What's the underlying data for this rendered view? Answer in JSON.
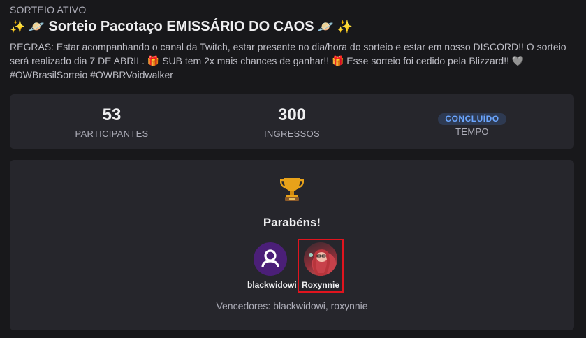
{
  "giveaway": {
    "status": "SORTEIO ATIVO",
    "title_emoji_left": "✨ 🪐",
    "title": "Sorteio Pacotaço EMISSÁRIO DO CAOS",
    "title_emoji_right": "🪐 ✨",
    "rules": "REGRAS: Estar acompanhando o canal da Twitch, estar presente no dia/hora do sorteio e estar em nosso DISCORD!! O sorteio será realizado dia 7 DE ABRIL. 🎁 SUB tem 2x mais chances de ganhar!! 🎁 Esse sorteio foi cedido pela Blizzard!! 🩶 #OWBrasilSorteio #OWBRVoidwalker"
  },
  "stats": {
    "participants_value": "53",
    "participants_label": "PARTICIPANTES",
    "tickets_value": "300",
    "tickets_label": "INGRESSOS",
    "time_badge": "CONCLUÍDO",
    "time_label": "TEMPO"
  },
  "result": {
    "trophy_icon": "trophy-icon",
    "congrats": "Parabéns!",
    "winners": [
      {
        "name": "blackwidowi",
        "avatar": "default-user-icon"
      },
      {
        "name": "Roxynnie",
        "avatar": "profile-photo"
      }
    ],
    "summary": "Vencedores: blackwidowi, roxynnie"
  },
  "colors": {
    "background": "#18181b",
    "card": "#26262c",
    "badge_text": "#6ba6ff",
    "highlight": "#e0141e"
  }
}
